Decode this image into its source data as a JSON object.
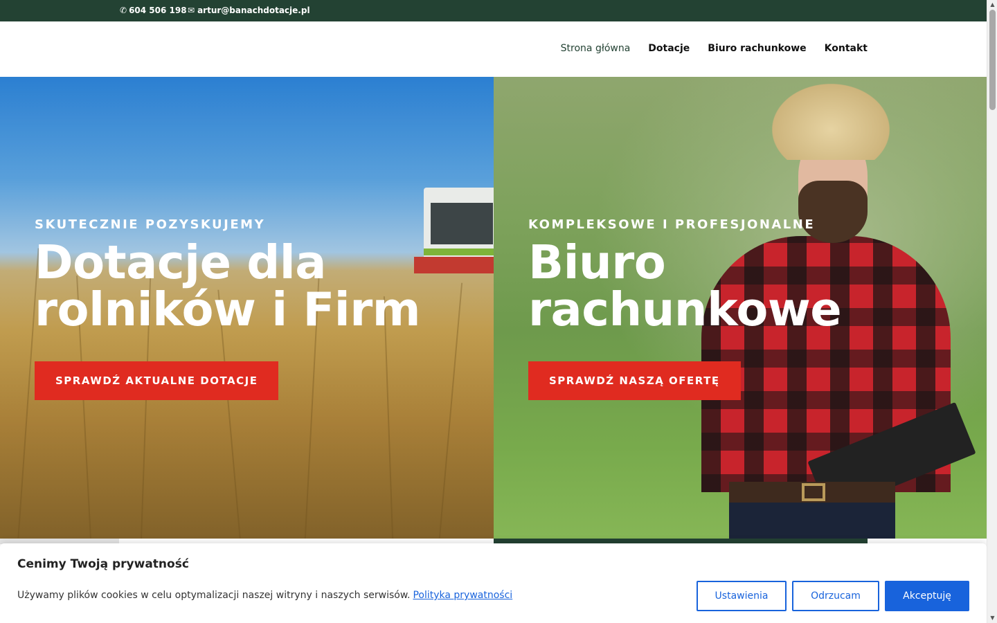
{
  "topbar": {
    "phone_icon": "phone-icon",
    "phone": "604 506 198",
    "email_icon": "envelope-icon",
    "email": "artur@banachdotacje.pl"
  },
  "nav": {
    "items": [
      {
        "label": "Strona główna",
        "active": true
      },
      {
        "label": "Dotacje",
        "active": false
      },
      {
        "label": "Biuro rachunkowe",
        "active": false
      },
      {
        "label": "Kontakt",
        "active": false
      }
    ]
  },
  "hero_left": {
    "eyebrow": "SKUTECZNIE POZYSKUJEMY",
    "title_line1": "Dotacje dla",
    "title_line2": "rolników i Firm",
    "button": "SPRAWDŹ AKTUALNE DOTACJE"
  },
  "hero_right": {
    "eyebrow": "KOMPLEKSOWE I PROFESJONALNE",
    "title_line1": "Biuro",
    "title_line2": "rachunkowe",
    "button": "SPRAWDŹ NASZĄ OFERTĘ"
  },
  "cookie": {
    "title": "Cenimy Twoją prywatność",
    "text": "Używamy plików cookies w celu optymalizacji naszej witryny i naszych serwisów.",
    "link": "Polityka prywatności",
    "settings": "Ustawienia",
    "reject": "Odrzucam",
    "accept": "Akceptuję"
  },
  "colors": {
    "topbar_bg": "#234233",
    "accent_red": "#e02b20",
    "cookie_blue": "#1863dc"
  }
}
